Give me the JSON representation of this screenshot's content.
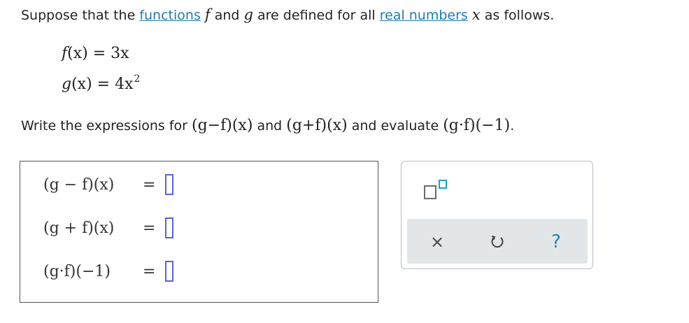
{
  "problem": {
    "intro_pre": "Suppose that the ",
    "link_functions": "functions",
    "var_f": "f",
    "and_word": " and ",
    "var_g": "g",
    "mid_text": " are defined for all ",
    "link_real_numbers": "real numbers",
    "var_x": "x",
    "outro": " as follows."
  },
  "definitions": {
    "f_lhs": "f",
    "f_arg": "(x)",
    "f_rhs": " = 3x",
    "g_lhs": "g",
    "g_arg": "(x)",
    "g_rhs": " = 4x",
    "g_exp": "2"
  },
  "instruction": {
    "pre": "Write the expressions for ",
    "expr1": "(g−f)(x)",
    "mid1": " and ",
    "expr2": "(g+f)(x)",
    "mid2": " and evaluate ",
    "expr3": "(g·f)(−1)",
    "end": "."
  },
  "answers": [
    {
      "lhs": "(g − f)(x)",
      "eq": "="
    },
    {
      "lhs": "(g + f)(x)",
      "eq": "="
    },
    {
      "lhs": "(g·f)(−1)",
      "eq": "="
    }
  ],
  "toolbar": {
    "clear_icon": "×",
    "undo_icon": "undo-icon",
    "help_icon": "?",
    "accent_color": "#1aa3c4",
    "slot_color": "#5a63d8"
  }
}
